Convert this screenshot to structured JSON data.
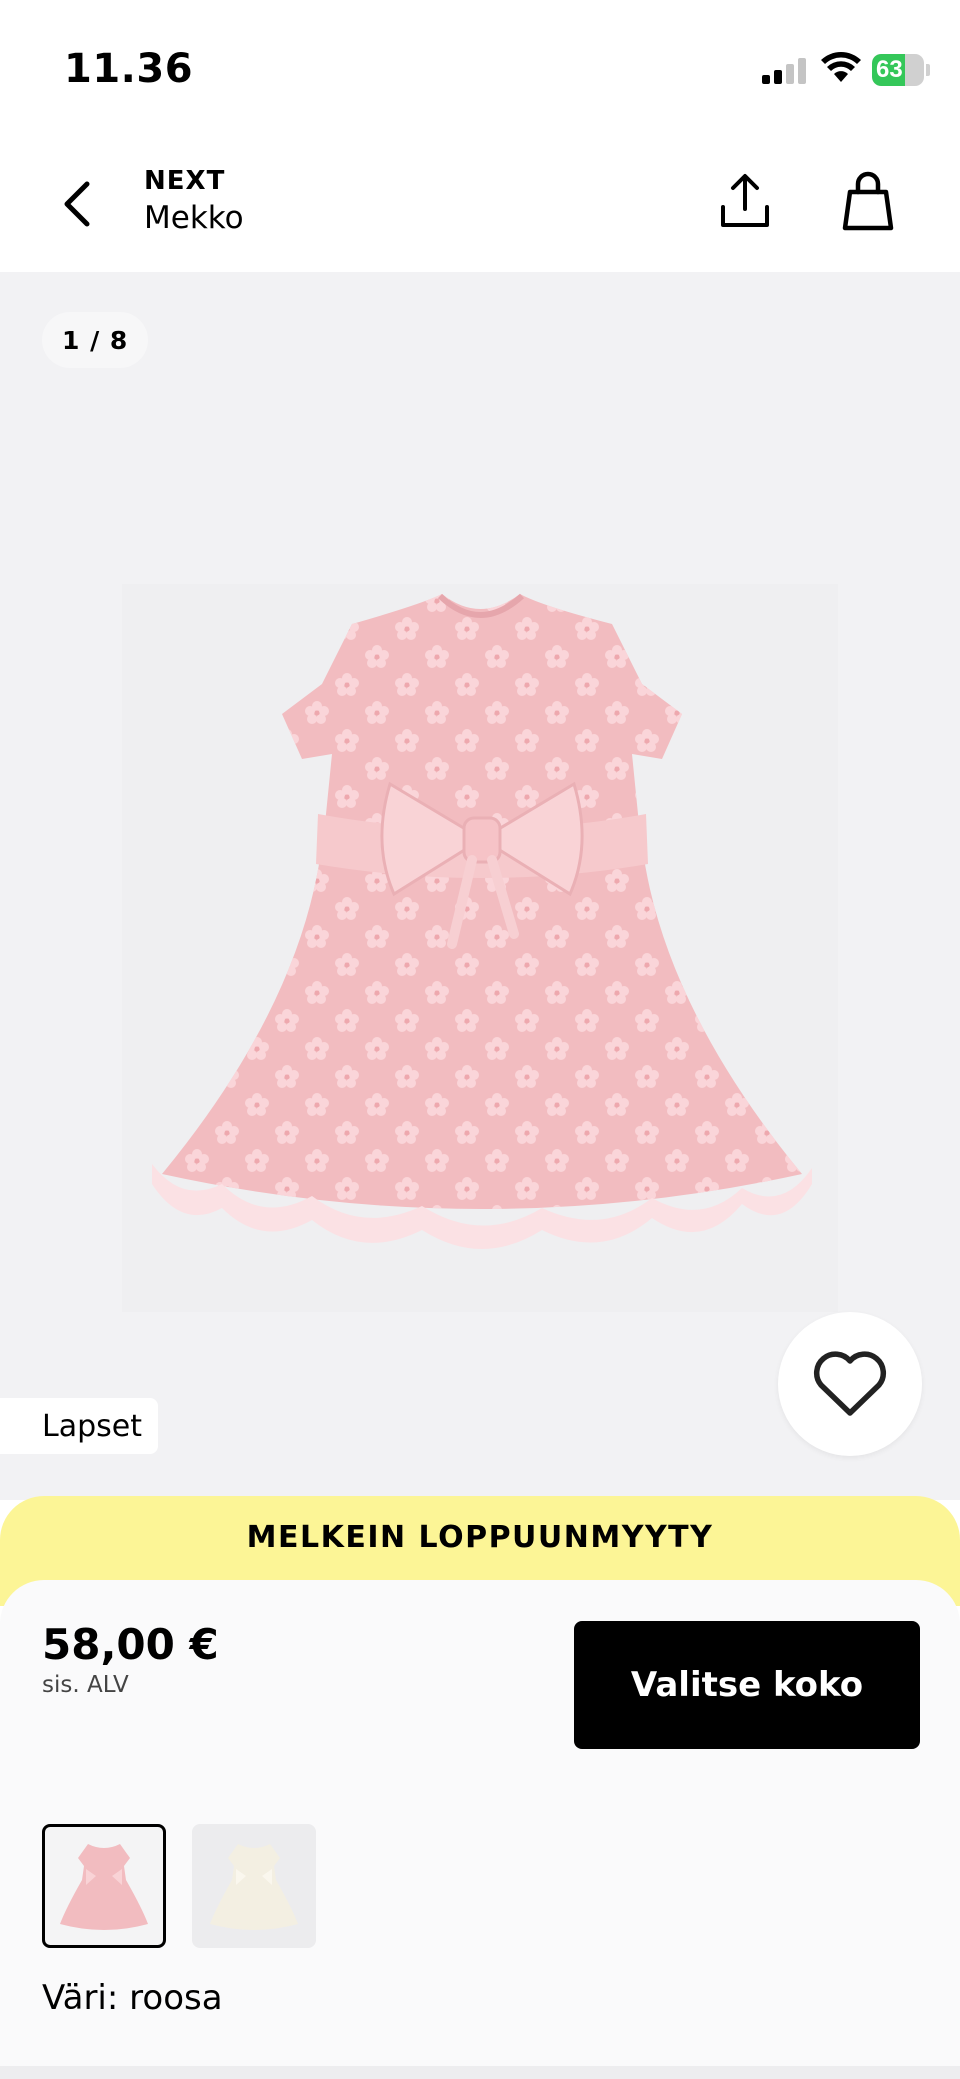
{
  "status_bar": {
    "time": "11.36",
    "battery": "63",
    "battery_level": 0.63
  },
  "header": {
    "brand": "NEXT",
    "title": "Mekko"
  },
  "gallery": {
    "counter": "1 / 8",
    "category": "Lapset"
  },
  "banner": {
    "text": "MELKEIN LOPPUUNMYYTY"
  },
  "product": {
    "price": "58,00 €",
    "vat_note": "sis. ALV",
    "select_size_label": "Valitse koko",
    "color_prefix": "Väri:",
    "color_value": "roosa"
  },
  "colors": {
    "accent": "#000000",
    "banner": "#fcf596",
    "dress_pink": "#f2bcc0",
    "dress_cream": "#f3efe2",
    "battery_green": "#34c759"
  },
  "icons": [
    "chevron-left-icon",
    "share-icon",
    "shopping-bag-icon",
    "heart-icon",
    "wifi-icon",
    "signal-icon",
    "battery-icon"
  ]
}
